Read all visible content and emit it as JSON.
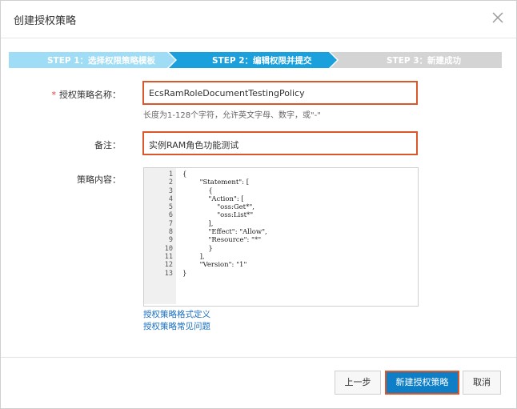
{
  "dialog": {
    "title": "创建授权策略"
  },
  "steps": [
    {
      "label": "STEP 1：选择权限策略模板",
      "state": "done"
    },
    {
      "label": "STEP 2：编辑权限并提交",
      "state": "active"
    },
    {
      "label": "STEP 3：新建成功",
      "state": "pending"
    }
  ],
  "form": {
    "name_required": "*",
    "name_label": "授权策略名称：",
    "name_value": "EcsRamRoleDocumentTestingPolicy",
    "name_hint": "长度为1-128个字符，允许英文字母、数字，或\"-\"",
    "note_label": "备注：",
    "note_value": "实例RAM角色功能测试",
    "content_label": "策略内容："
  },
  "editor": {
    "line_numbers": "1\n2\n3\n4\n5\n6\n7\n8\n9\n10\n11\n12\n13",
    "code": "{\n        \"Statement\": [\n            {\n            \"Action\": [\n                \"oss:Get*\",\n                \"oss:List*\"\n            ],\n            \"Effect\": \"Allow\",\n            \"Resource\": \"*\"\n            }\n        ],\n        \"Version\": \"1\"\n}"
  },
  "links": {
    "syntax": "授权策略格式定义",
    "faq": "授权策略常见问题"
  },
  "buttons": {
    "prev": "上一步",
    "create": "新建授权策略",
    "cancel": "取消"
  },
  "colors": {
    "step_done": "#9fdcf5",
    "step_active": "#1aa0dc",
    "step_pending": "#d4d4d4",
    "highlight_border": "#d9572b",
    "primary": "#0e7fc6",
    "link": "#1a6fbf"
  },
  "icons": {
    "close": "close-icon"
  }
}
